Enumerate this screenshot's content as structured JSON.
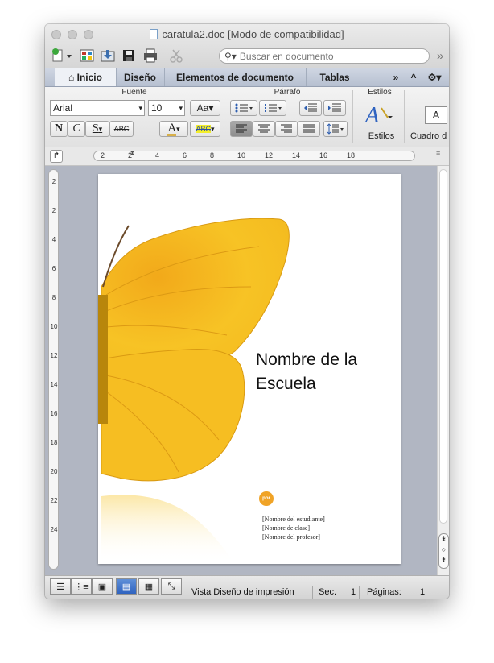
{
  "window": {
    "title": "caratula2.doc [Modo de compatibilidad]"
  },
  "search": {
    "placeholder": "Buscar en documento"
  },
  "tabs": [
    {
      "label": "Inicio"
    },
    {
      "label": "Diseño"
    },
    {
      "label": "Elementos de documento"
    },
    {
      "label": "Tablas"
    }
  ],
  "ribbon": {
    "font_group": "Fuente",
    "paragraph_group": "Párrafo",
    "styles_group": "Estilos",
    "font_name": "Arial",
    "font_size": "10",
    "bold": "N",
    "italic": "C",
    "underline": "S",
    "strike": "ABC",
    "styles_label": "Estilos",
    "cuadro_label": "Cuadro d"
  },
  "ruler": {
    "h_numbers": [
      "2",
      "2",
      "4",
      "6",
      "8",
      "10",
      "12",
      "14",
      "16",
      "18"
    ],
    "v_numbers": [
      "2",
      "2",
      "4",
      "6",
      "8",
      "10",
      "12",
      "14",
      "16",
      "18",
      "20",
      "22",
      "24"
    ]
  },
  "document": {
    "school_line1": "Nombre de la",
    "school_line2": "Escuela",
    "badge": "por",
    "student": "[Nombre del estudiante]",
    "class": "[Nombre de clase]",
    "teacher": "[Nombre del profesor]"
  },
  "status": {
    "view": "Vista Diseño de impresión",
    "sec_label": "Sec.",
    "sec_value": "1",
    "pages_label": "Páginas:",
    "pages_value": "1"
  },
  "colors": {
    "accent": "#f0a326",
    "butterfly": "#f5bf1e",
    "window_bg": "#ececec"
  }
}
